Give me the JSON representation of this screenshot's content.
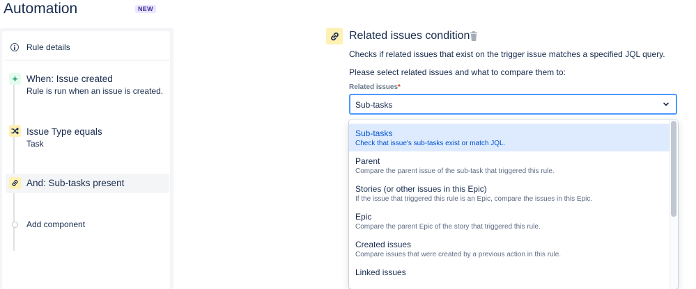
{
  "header": {
    "title": "Automation",
    "badge": "NEW"
  },
  "sidebar": {
    "rule_details": "Rule details",
    "steps": [
      {
        "icon": "plus-icon",
        "title": "When: Issue created",
        "subtitle": "Rule is run when an issue is created."
      },
      {
        "icon": "shuffle-icon",
        "title": "Issue Type equals",
        "subtitle": "Task"
      },
      {
        "icon": "link-icon",
        "title": "And: Sub-tasks present"
      }
    ],
    "add_component": "Add component"
  },
  "condition": {
    "title": "Related issues condition",
    "description": "Checks if related issues that exist on the trigger issue matches a specified JQL query.",
    "prompt": "Please select related issues and what to compare them to:",
    "field_label": "Related issues",
    "required_marker": "*",
    "selected_value": "Sub-tasks",
    "options": [
      {
        "label": "Sub-tasks",
        "description": "Check that issue's sub-tasks exist or match JQL."
      },
      {
        "label": "Parent",
        "description": "Compare the parent issue of the sub-task that triggered this rule."
      },
      {
        "label": "Stories (or other issues in this Epic)",
        "description": "If the issue that triggered this rule is an Epic, compare the issues in this Epic."
      },
      {
        "label": "Epic",
        "description": "Compare the parent Epic of the story that triggered this rule."
      },
      {
        "label": "Created issues",
        "description": "Compare issues that were created by a previous action in this rule."
      },
      {
        "label": "Linked issues",
        "description": ""
      }
    ]
  },
  "colors": {
    "accent": "#0052cc",
    "selected_bg": "#deebff",
    "focus_border": "#4c9aff",
    "condition_icon_bg": "#fff0b3",
    "trigger_icon_bg": "#e3fcef"
  }
}
